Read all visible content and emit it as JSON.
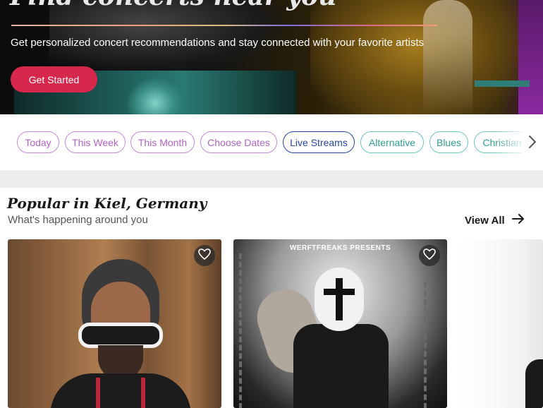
{
  "hero": {
    "title": "Find concerts near you",
    "subtitle": "Get personalized concert recommendations and stay connected with your favorite artists",
    "cta_label": "Get Started"
  },
  "filters": {
    "chips": [
      {
        "label": "Today"
      },
      {
        "label": "This Week"
      },
      {
        "label": "This Month"
      },
      {
        "label": "Choose Dates"
      },
      {
        "label": "Live Streams"
      },
      {
        "label": "Alternative"
      },
      {
        "label": "Blues"
      },
      {
        "label": "Christian"
      }
    ],
    "next_icon": "chevron-right-icon"
  },
  "popular": {
    "title": "Popular in Kiel, Germany",
    "subtitle": "What's happening around you",
    "view_all_label": "View All",
    "view_all_icon": "arrow-right-icon",
    "cards": [
      {
        "favorite_icon": "heart-icon"
      },
      {
        "banner": "WERFTFREAKS PRESENTS",
        "favorite_icon": "heart-icon"
      },
      {}
    ]
  },
  "colors": {
    "accent": "#d8274c",
    "chip_purple": "#b262c8",
    "chip_blue": "#2a45a8",
    "chip_teal": "#2f9e93"
  }
}
